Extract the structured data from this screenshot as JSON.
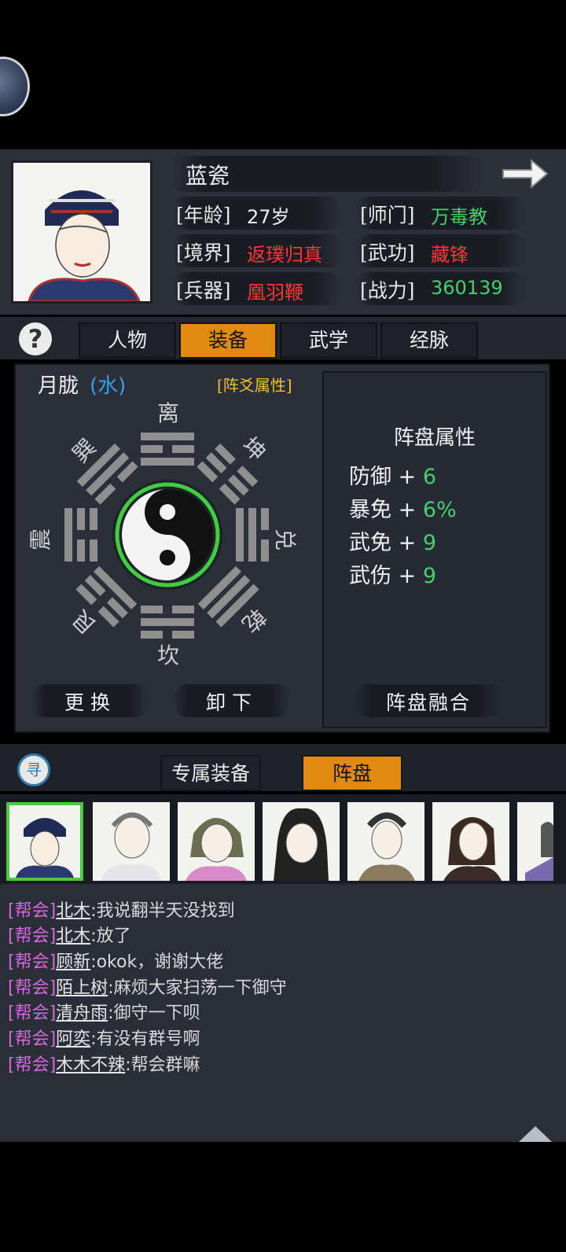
{
  "character": {
    "name": "蓝瓷",
    "age_label": "[年龄]",
    "age_value": "27岁",
    "sect_label": "[师门]",
    "sect_value": "万毒教",
    "realm_label": "[境界]",
    "realm_value": "返璞归真",
    "martial_label": "[武功]",
    "martial_value": "藏锋",
    "weapon_label": "[兵器]",
    "weapon_value": "凰羽鞭",
    "power_label": "[战力]",
    "power_value": "360139"
  },
  "help_label": "?",
  "tabs": [
    {
      "label": "人物",
      "active": false
    },
    {
      "label": "装备",
      "active": true
    },
    {
      "label": "武学",
      "active": false
    },
    {
      "label": "经脉",
      "active": false
    }
  ],
  "formation": {
    "name": "月胧",
    "element": "(水)",
    "attr_link": "[阵爻属性]",
    "trigrams": {
      "top": "离",
      "top_right": "坤",
      "right": "兑",
      "bottom_right": "乾",
      "bottom": "坎",
      "bottom_left": "艮",
      "left": "震",
      "top_left": "巽"
    },
    "panel_title": "阵盘属性",
    "attributes": [
      {
        "name": "防御",
        "plus": "+",
        "value": "6"
      },
      {
        "name": "暴免",
        "plus": "+",
        "value": "6%"
      },
      {
        "name": "武免",
        "plus": "+",
        "value": "9"
      },
      {
        "name": "武伤",
        "plus": "+",
        "value": "9"
      }
    ],
    "replace_label": "更换",
    "unequip_label": "卸下",
    "fuse_label": "阵盘融合"
  },
  "lower_tabs": [
    {
      "label": "专属装备",
      "active": false
    },
    {
      "label": "阵盘",
      "active": true
    }
  ],
  "search_icon_char": "寻",
  "chat": [
    {
      "tag": "[帮会]",
      "name": "北木",
      "text": ":我说翻半天没找到"
    },
    {
      "tag": "[帮会]",
      "name": "北木",
      "text": ":放了"
    },
    {
      "tag": "[帮会]",
      "name": "顾新",
      "text": ":okok，谢谢大佬"
    },
    {
      "tag": "[帮会]",
      "name": "陌上树",
      "text": ":麻烦大家扫荡一下御守"
    },
    {
      "tag": "[帮会]",
      "name": "清舟雨",
      "text": ":御守一下呗"
    },
    {
      "tag": "[帮会]",
      "name": "阿奕",
      "text": ":有没有群号啊"
    },
    {
      "tag": "[帮会]",
      "name": "木木不辣",
      "text": ":帮会群嘛"
    }
  ],
  "colors": {
    "accent_orange": "#e08a12",
    "stat_green": "#45d06a",
    "stat_red": "#ff3434",
    "guild_tag": "#d46ad8",
    "selection_green": "#4ec742"
  }
}
